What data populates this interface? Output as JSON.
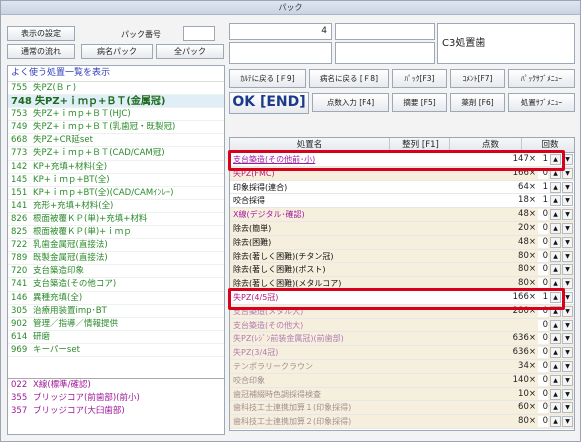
{
  "window": {
    "title": "パック"
  },
  "top_left": {
    "btn_settings": "表示の設定",
    "pack_no_label": "パック番号",
    "btn_normal_flow": "通常の流れ",
    "btn_disease_pack": "病名パック",
    "btn_all_pack": "全パック"
  },
  "info": {
    "count": "4",
    "label": "C3処置歯"
  },
  "fkeys": {
    "karte_back": "ｶﾙﾃに戻る [Ｆ9]",
    "disease_back": "病名に戻る [Ｆ8]",
    "pack": "ﾊﾟｯｸ[F3]",
    "comment": "ｺﾒﾝﾄ[F7]",
    "pack_sub_menu": "ﾊﾟｯｸｻﾌﾞﾒﾆｭｰ",
    "ok": "OK [END]",
    "points_input": "点数入力 [F4]",
    "summary": "摘要 [F5]",
    "drug": "薬剤 [F6]",
    "treat_sub_menu": "処置ｻﾌﾞﾒﾆｭｰ"
  },
  "left_panel": {
    "header": "よく使う処置一覧を表示",
    "items": [
      {
        "code": "755",
        "label": "失PZ(Ｂｒ)"
      },
      {
        "code": "748",
        "label": "失PZ+ｉｍｐ+ＢＴ(金属冠)"
      },
      {
        "code": "753",
        "label": "失PZ+ｉｍｐ+ＢＴ(HJC)"
      },
      {
        "code": "749",
        "label": "失PZ+ｉｍｐ+ＢＴ(乳歯冠・既製冠)"
      },
      {
        "code": "668",
        "label": "失PZ+CR延set"
      },
      {
        "code": "773",
        "label": "失PZ+ｉｍｐ+ＢＴ(CAD/CAM冠)"
      },
      {
        "code": "142",
        "label": "KP+充填+材料(全)"
      },
      {
        "code": "145",
        "label": "KP+ｉｍｐ+BT(全)"
      },
      {
        "code": "151",
        "label": "KP+ｉｍｐ+BT(全)(CAD/CAMｲﾝﾚｰ)"
      },
      {
        "code": "141",
        "label": "充形+充填+材料(全)"
      },
      {
        "code": "826",
        "label": "根面被覆ＫＰ(単)+充填+材料"
      },
      {
        "code": "825",
        "label": "根面被覆ＫＰ(単)+ｉｍｐ"
      },
      {
        "code": "722",
        "label": "乳歯金属冠(直接法)"
      },
      {
        "code": "789",
        "label": "既製金属冠(直接法)"
      },
      {
        "code": "720",
        "label": "支台築造印象"
      },
      {
        "code": "741",
        "label": "支台築造(その他コア)"
      },
      {
        "code": "146",
        "label": "異種充填(全)"
      },
      {
        "code": "305",
        "label": "治療用装置imp･BT"
      },
      {
        "code": "902",
        "label": "管理／指導／情報提供"
      },
      {
        "code": "614",
        "label": "研磨"
      },
      {
        "code": "969",
        "label": "キーパーset"
      }
    ],
    "items2": [
      {
        "code": "022",
        "label": "X線(標準/確認)"
      },
      {
        "code": "355",
        "label": "ブリッジコア(前歯部)(前小)"
      },
      {
        "code": "357",
        "label": "ブリッジコア(大臼歯部)"
      }
    ]
  },
  "table": {
    "col_name": "処置名",
    "col_sort": "整列 [F1]",
    "col_points": "点数",
    "col_times": "回数",
    "rows": [
      {
        "name": "支台築造(その他前･小)",
        "points": "147×",
        "qty": "1",
        "color": "#a01aa0",
        "bg": "#ffffff",
        "underline": true
      },
      {
        "name": "失PZ(FMC)",
        "points": "166×",
        "qty": "0",
        "color": "#b01a78",
        "bg": "#f7efde"
      },
      {
        "name": "印象採得(連合)",
        "points": "64×",
        "qty": "1",
        "color": "#111111",
        "bg": "#ffffff"
      },
      {
        "name": "咬合採得",
        "points": "18×",
        "qty": "1",
        "color": "#111111",
        "bg": "#ffffff"
      },
      {
        "name": "X線(デジタル･確認)",
        "points": "48×",
        "qty": "0",
        "color": "#a01aa0",
        "bg": "#f7efde"
      },
      {
        "name": "除去(簡単)",
        "points": "20×",
        "qty": "0",
        "color": "#111111",
        "bg": "#f7efde"
      },
      {
        "name": "除去(困難)",
        "points": "48×",
        "qty": "0",
        "color": "#111111",
        "bg": "#f7efde"
      },
      {
        "name": "除去(著しく困難)(チタン冠)",
        "points": "80×",
        "qty": "0",
        "color": "#111111",
        "bg": "#f7efde"
      },
      {
        "name": "除去(著しく困難)(ポスト)",
        "points": "80×",
        "qty": "0",
        "color": "#111111",
        "bg": "#f7efde"
      },
      {
        "name": "除去(著しく困難)(メタルコア)",
        "points": "80×",
        "qty": "0",
        "color": "#111111",
        "bg": "#f7efde"
      },
      {
        "name": "失PZ(4/5冠)",
        "points": "166×",
        "qty": "1",
        "color": "#b01a78",
        "bg": "#ffffff"
      },
      {
        "name": "支台築造(メタル大)",
        "points": "280×",
        "qty": "0",
        "color": "#b07ab0",
        "bg": "#f7efde"
      },
      {
        "name": "支台築造(その他大)",
        "points": "",
        "qty": "0",
        "color": "#b07ab0",
        "bg": "#f7efde",
        "hidden_points": true
      },
      {
        "name": "失PZ(ﾚｼﾞﾝ前装金属冠)(前歯部)",
        "points": "636×",
        "qty": "0",
        "color": "#b07ab0",
        "bg": "#f7efde"
      },
      {
        "name": "失PZ(3/4冠)",
        "points": "636×",
        "qty": "0",
        "color": "#b07ab0",
        "bg": "#f7efde"
      },
      {
        "name": "テンポラリークラウン",
        "points": "34×",
        "qty": "0",
        "color": "#a09090",
        "bg": "#f7efde"
      },
      {
        "name": "咬合印象",
        "points": "140×",
        "qty": "0",
        "color": "#a09090",
        "bg": "#f7efde"
      },
      {
        "name": "歯冠補綴時色調採得検査",
        "points": "10×",
        "qty": "0",
        "color": "#a09090",
        "bg": "#f7efde"
      },
      {
        "name": "歯科技工士連携加算１(印象採得)",
        "points": "60×",
        "qty": "0",
        "color": "#a09090",
        "bg": "#f7efde"
      },
      {
        "name": "歯科技工士連携加算２(印象採得)",
        "points": "80×",
        "qty": "0",
        "color": "#a09090",
        "bg": "#f7efde"
      }
    ]
  },
  "icons": {
    "up": "▲",
    "down": "▼"
  },
  "colors": {
    "highlight_border": "#d9001b",
    "accent_blue": "#1c3a8a",
    "list_green": "#2a8a2a"
  }
}
